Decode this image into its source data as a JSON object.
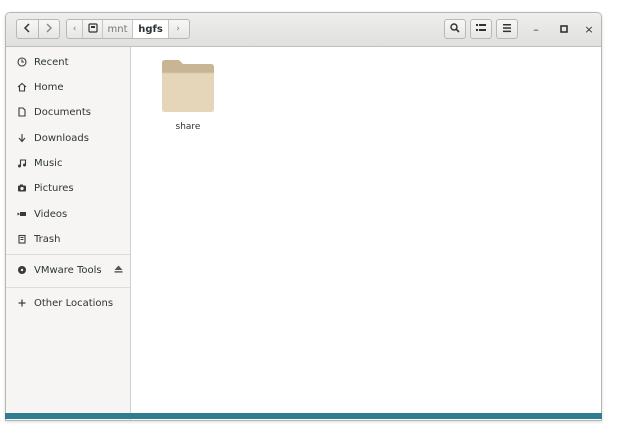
{
  "toolbar": {
    "back_icon": "chevron-left-icon",
    "forward_icon": "chevron-right-icon",
    "path_scroll_left": "‹",
    "path_scroll_right": "›",
    "path_segments": [
      "mnt",
      "hgfs"
    ],
    "search_icon": "search-icon",
    "view_icon": "view-options-icon",
    "menu_icon": "hamburger-menu-icon"
  },
  "window_controls": {
    "minimize": "–",
    "maximize": "▫",
    "close": "×"
  },
  "sidebar": {
    "places": [
      {
        "label": "Recent",
        "icon": "recent-clock-icon"
      },
      {
        "label": "Home",
        "icon": "home-icon"
      },
      {
        "label": "Documents",
        "icon": "document-icon"
      },
      {
        "label": "Downloads",
        "icon": "download-arrow-icon"
      },
      {
        "label": "Music",
        "icon": "music-note-icon"
      },
      {
        "label": "Pictures",
        "icon": "camera-icon"
      },
      {
        "label": "Videos",
        "icon": "video-camera-icon"
      },
      {
        "label": "Trash",
        "icon": "trash-icon"
      }
    ],
    "devices": [
      {
        "label": "VMware Tools",
        "icon": "disc-icon",
        "eject_icon": "eject-icon"
      }
    ],
    "other": [
      {
        "label": "Other Locations",
        "icon": "plus-icon"
      }
    ]
  },
  "content": {
    "items": [
      {
        "name": "share",
        "icon": "folder-icon"
      }
    ]
  },
  "colors": {
    "folder_body": "#e6d6b9",
    "folder_tab": "#c8b595",
    "accent_strip": "#2f7d93"
  }
}
